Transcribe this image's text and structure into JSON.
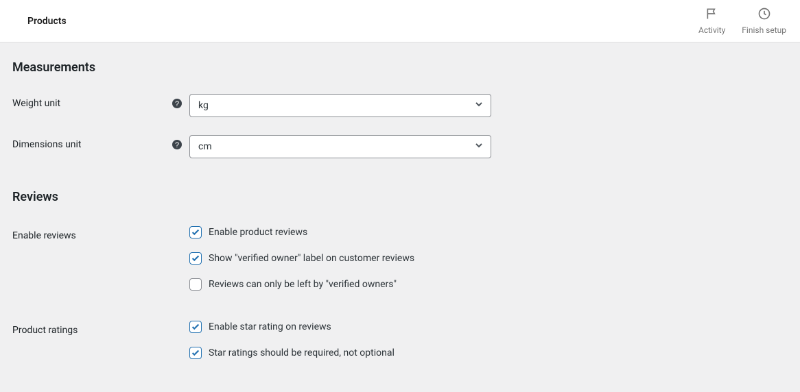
{
  "topbar": {
    "title": "Products",
    "activity_label": "Activity",
    "finish_label": "Finish setup"
  },
  "sections": {
    "measurements_heading": "Measurements",
    "reviews_heading": "Reviews"
  },
  "weight": {
    "label": "Weight unit",
    "value": "kg"
  },
  "dimensions": {
    "label": "Dimensions unit",
    "value": "cm"
  },
  "enable_reviews": {
    "label": "Enable reviews",
    "opt1": "Enable product reviews",
    "opt2": "Show \"verified owner\" label on customer reviews",
    "opt3": "Reviews can only be left by \"verified owners\""
  },
  "product_ratings": {
    "label": "Product ratings",
    "opt1": "Enable star rating on reviews",
    "opt2": "Star ratings should be required, not optional"
  }
}
